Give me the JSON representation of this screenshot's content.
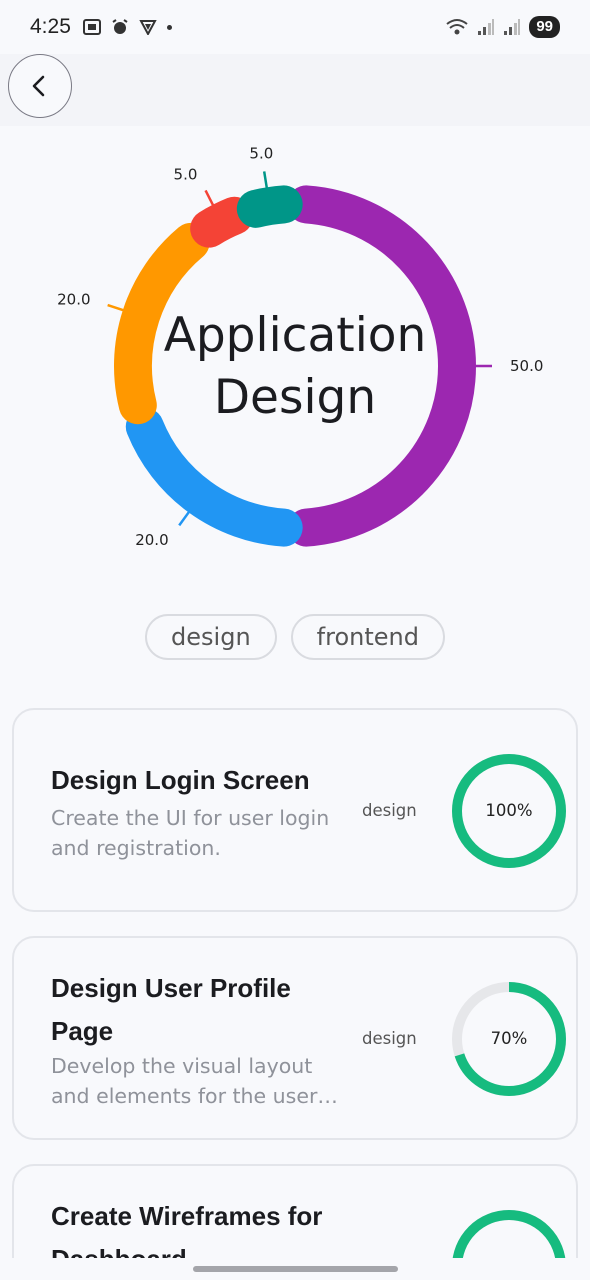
{
  "status_bar": {
    "time": "4:25",
    "battery": "99",
    "icons": [
      "screenshot-icon",
      "alarm-icon",
      "vpn-icon",
      "wifi-icon",
      "signal-icon",
      "signal-icon"
    ]
  },
  "header": {
    "back_icon": "chevron-left-icon"
  },
  "project": {
    "title_line1": "Application",
    "title_line2": "Design",
    "tags": [
      "design",
      "frontend"
    ]
  },
  "chart_data": {
    "type": "pie",
    "title": "Application Design",
    "slices": [
      {
        "label": "50.0",
        "value": 50.0,
        "color": "#9c27b0"
      },
      {
        "label": "20.0",
        "value": 20.0,
        "color": "#2196f3"
      },
      {
        "label": "20.0",
        "value": 20.0,
        "color": "#ff9800"
      },
      {
        "label": "5.0",
        "value": 5.0,
        "color": "#f44336"
      },
      {
        "label": "5.0",
        "value": 5.0,
        "color": "#009688"
      }
    ]
  },
  "tasks": [
    {
      "title": "Design Login Screen",
      "description": "Create the UI for user login and registration.",
      "tag": "design",
      "progress": 100,
      "progress_label": "100%"
    },
    {
      "title": "Design User Profile Page",
      "description": "Develop the visual layout and elements for the user profile page.",
      "tag": "design",
      "progress": 70,
      "progress_label": "70%"
    },
    {
      "title": "Create Wireframes for Dashboard",
      "description": "",
      "tag": "",
      "progress": 100,
      "progress_label": ""
    }
  ],
  "colors": {
    "progress": "#16bb7f",
    "progress_track": "#e6e7ea"
  }
}
